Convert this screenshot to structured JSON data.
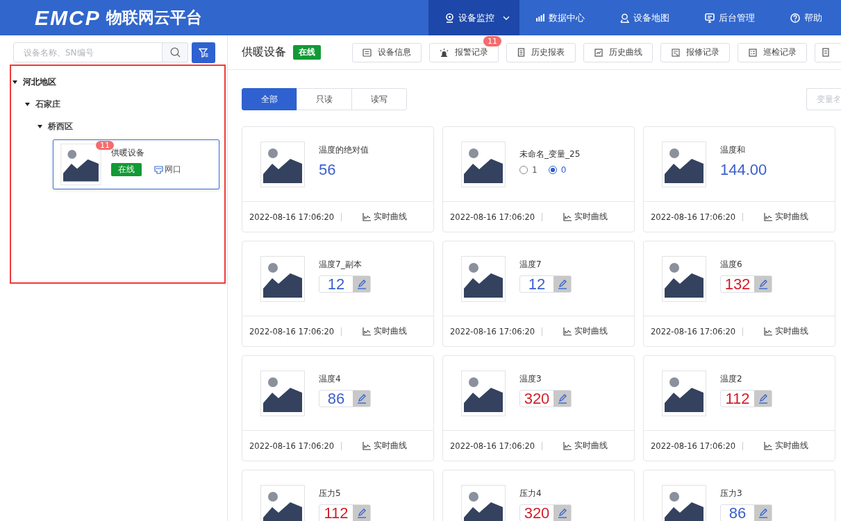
{
  "header": {
    "logo": "EMCP",
    "title": "物联网云平台",
    "nav": [
      {
        "label": "设备监控",
        "selected": true
      },
      {
        "label": "数据中心",
        "selected": false
      },
      {
        "label": "设备地图",
        "selected": false
      },
      {
        "label": "后台管理",
        "selected": false
      },
      {
        "label": "帮助",
        "selected": false
      }
    ]
  },
  "sidebar": {
    "search": {
      "placeholder": "设备名称、SN编号"
    },
    "tree": [
      {
        "label": "河北地区",
        "expanded": true,
        "children": [
          {
            "label": "石家庄",
            "expanded": true,
            "children": [
              {
                "label": "桥西区",
                "expanded": true,
                "devices": [
                  {
                    "name": "供暖设备",
                    "badge": "11",
                    "status": "在线",
                    "network": "网口"
                  }
                ]
              }
            ]
          }
        ]
      }
    ]
  },
  "device": {
    "name": "供暖设备",
    "status": "在线",
    "toolbar": [
      {
        "label": "设备信息"
      },
      {
        "label": "报警记录",
        "badge": "11"
      },
      {
        "label": "历史报表"
      },
      {
        "label": "历史曲线"
      },
      {
        "label": "报修记录"
      },
      {
        "label": "巡检记录"
      }
    ],
    "filter_tabs": [
      {
        "label": "全部",
        "selected": true
      },
      {
        "label": "只读",
        "selected": false
      },
      {
        "label": "读写",
        "selected": false
      }
    ],
    "search": {
      "placeholder": "变量名"
    },
    "variables": [
      {
        "kind": "value",
        "name": "温度的绝对值",
        "value": "56",
        "alarm": false,
        "time": "2022-08-16 17:06:20",
        "link": "实时曲线"
      },
      {
        "kind": "radio",
        "name": "未命名_变量_25",
        "options": [
          {
            "label": "1",
            "selected": false
          },
          {
            "label": "0",
            "selected": true
          }
        ],
        "time": "2022-08-16 17:06:20",
        "link": "实时曲线"
      },
      {
        "kind": "value",
        "name": "温度和",
        "value": "144.00",
        "alarm": false,
        "time": "2022-08-16 17:06:20",
        "link": "实时曲线"
      },
      {
        "kind": "editable",
        "name": "温度7_副本",
        "value": "12",
        "alarm": false,
        "time": "2022-08-16 17:06:20",
        "link": "实时曲线"
      },
      {
        "kind": "editable",
        "name": "温度7",
        "value": "12",
        "alarm": false,
        "time": "2022-08-16 17:06:20",
        "link": "实时曲线"
      },
      {
        "kind": "editable",
        "name": "温度6",
        "value": "132",
        "alarm": true,
        "time": "2022-08-16 17:06:20",
        "link": "实时曲线"
      },
      {
        "kind": "editable",
        "name": "温度4",
        "value": "86",
        "alarm": false,
        "time": "2022-08-16 17:06:20",
        "link": "实时曲线"
      },
      {
        "kind": "editable",
        "name": "温度3",
        "value": "320",
        "alarm": true,
        "time": "2022-08-16 17:06:20",
        "link": "实时曲线"
      },
      {
        "kind": "editable",
        "name": "温度2",
        "value": "112",
        "alarm": true,
        "time": "2022-08-16 17:06:20",
        "link": "实时曲线"
      },
      {
        "kind": "editable",
        "name": "压力5",
        "value": "112",
        "alarm": true
      },
      {
        "kind": "editable",
        "name": "压力4",
        "value": "320",
        "alarm": true
      },
      {
        "kind": "editable",
        "name": "压力3",
        "value": "86",
        "alarm": false
      }
    ]
  }
}
